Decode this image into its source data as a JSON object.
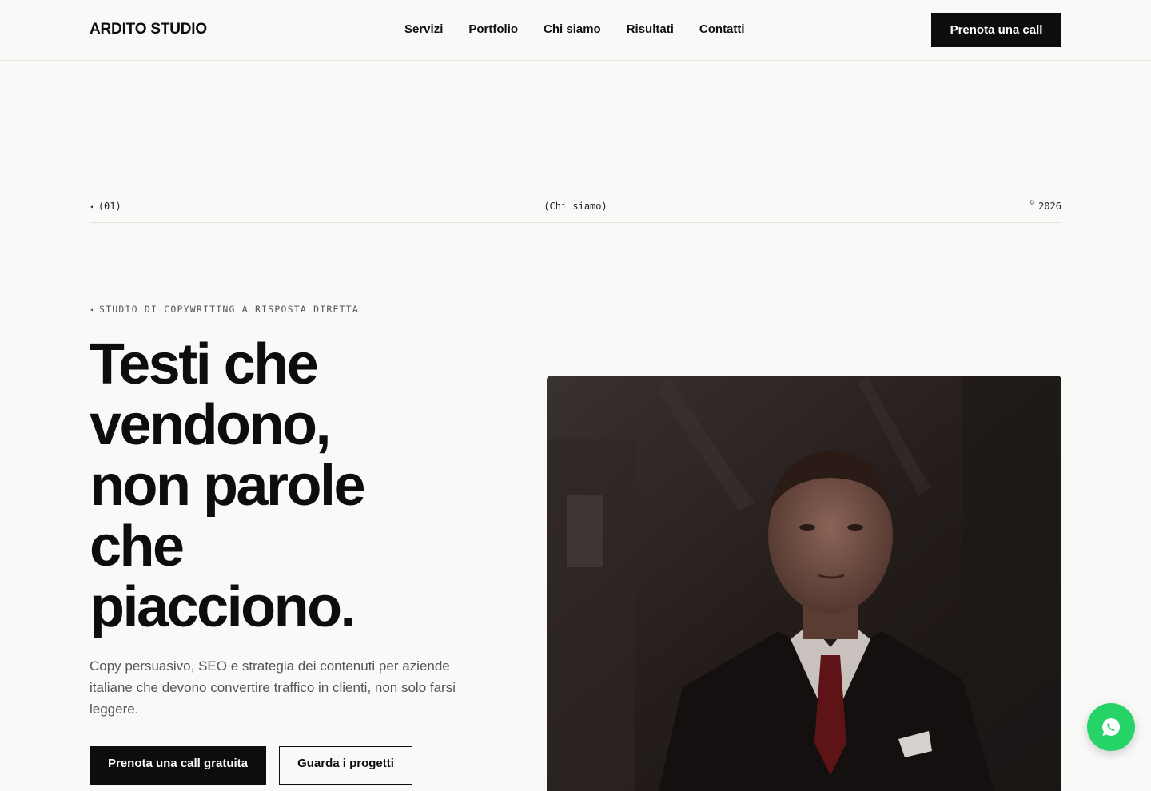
{
  "header": {
    "brand": "ARDITO STUDIO",
    "nav": [
      "Servizi",
      "Portfolio",
      "Chi siamo",
      "Risultati",
      "Contatti"
    ],
    "cta": "Prenota una call"
  },
  "meta_bar": {
    "left_marker": "◂",
    "left": "(01)",
    "center": "(Chi siamo)",
    "right_symbol": "©",
    "right": "2026"
  },
  "hero": {
    "eyebrow_marker": "◂",
    "eyebrow": "STUDIO DI COPYWRITING A RISPOSTA DIRETTA",
    "headline_lines": [
      "Testi che",
      "vendono,",
      "non parole",
      "che",
      "piacciono."
    ],
    "subtitle": "Copy persuasivo, SEO e strategia dei contenuti per aziende italiane che devono convertire traffico in clienti, non solo farsi leggere.",
    "primary_cta": "Prenota una call gratuita",
    "secondary_cta": "Guarda i progetti"
  },
  "image": {
    "subject": "man-in-dark-suit-portrait-icon"
  },
  "floating": {
    "icon": "whatsapp-icon",
    "color": "#25d366"
  },
  "colors": {
    "background": "#f9f9f7",
    "ink": "#0d0d0d",
    "muted": "#555555"
  }
}
